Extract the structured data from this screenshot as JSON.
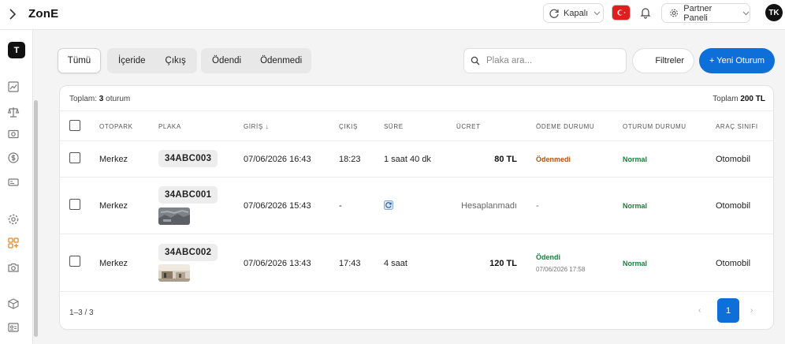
{
  "app": {
    "brand": "ZonE",
    "sidebar_logo": "T"
  },
  "topbar": {
    "status_label": "Kapalı",
    "partner_label": "Partner Paneli",
    "avatar_initials": "TK",
    "flag_icon": "turkey-flag-icon"
  },
  "colors": {
    "primary": "#0f6fd8",
    "unpaid": "#b45309",
    "paid": "#15803d"
  },
  "filters": {
    "all": "Tümü",
    "inside": "İçeride",
    "exit": "Çıkış",
    "paid": "Ödendi",
    "unpaid": "Ödenmedi"
  },
  "search": {
    "placeholder": "Plaka ara..."
  },
  "buttons": {
    "filters": "Filtreler",
    "new_session": "+ Yeni Oturum"
  },
  "summary": {
    "total_label": "Toplam:",
    "total_count": "3",
    "total_unit": "oturum",
    "total_amount_label": "Toplam",
    "total_amount": "200 TL"
  },
  "columns": {
    "otopark": "OTOPARK",
    "plaka": "PLAKA",
    "giris": "GİRİŞ ↓",
    "cikis": "ÇIKIŞ",
    "sure": "SÜRE",
    "ucret": "ÜCRET",
    "odeme": "ÖDEME DURUMU",
    "oturum": "OTURUM DURUMU",
    "arac": "ARAÇ SINIFI"
  },
  "rows": [
    {
      "otopark": "Merkez",
      "plaka": "34ABC003",
      "giris": "07/06/2026 16:43",
      "cikis": "18:23",
      "sure": "1 saat 40 dk",
      "ucret": "80 TL",
      "odeme": "Ödenmedi",
      "odeme_tarih": "",
      "oturum": "Normal",
      "arac": "Otomobil"
    },
    {
      "otopark": "Merkez",
      "plaka": "34ABC001",
      "giris": "07/06/2026 15:43",
      "cikis": "-",
      "sure": "",
      "ucret": "Hesaplanmadı",
      "odeme": "-",
      "odeme_tarih": "",
      "oturum": "Normal",
      "arac": "Otomobil"
    },
    {
      "otopark": "Merkez",
      "plaka": "34ABC002",
      "giris": "07/06/2026 13:43",
      "cikis": "17:43",
      "sure": "4 saat",
      "ucret": "120 TL",
      "odeme": "Ödendi",
      "odeme_tarih": "07/06/2026 17:58",
      "oturum": "Normal",
      "arac": "Otomobil"
    }
  ],
  "pagination": {
    "range": "1–3 / 3",
    "prev": "‹",
    "current": "1",
    "next": "›"
  }
}
